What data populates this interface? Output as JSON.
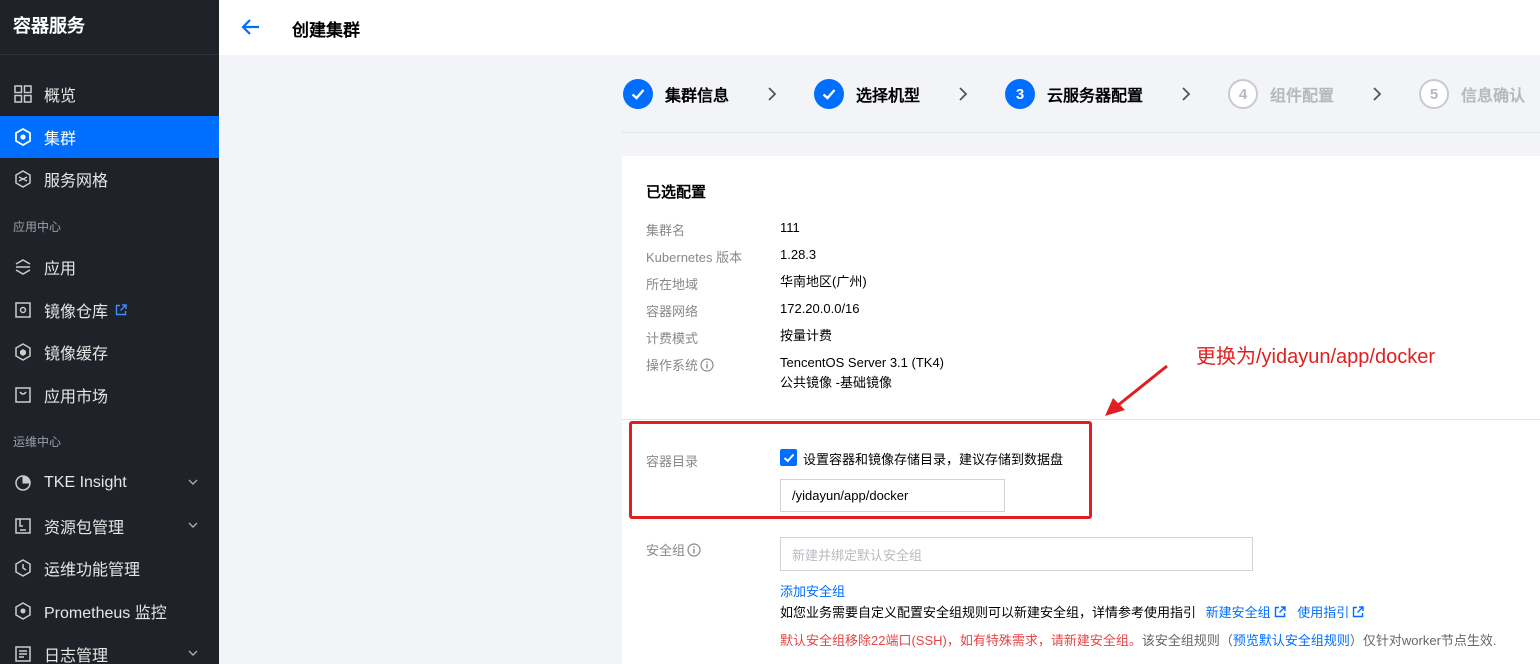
{
  "app": {
    "title": "容器服务"
  },
  "sidebar": {
    "items": [
      {
        "label": "概览"
      },
      {
        "label": "集群"
      },
      {
        "label": "服务网格"
      },
      {
        "label": "应用"
      },
      {
        "label": "镜像仓库"
      },
      {
        "label": "镜像缓存"
      },
      {
        "label": "应用市场"
      },
      {
        "label": "TKE Insight"
      },
      {
        "label": "资源包管理"
      },
      {
        "label": "运维功能管理"
      },
      {
        "label": "Prometheus 监控"
      },
      {
        "label": "日志管理"
      }
    ],
    "sections": [
      "应用中心",
      "运维中心"
    ]
  },
  "header": {
    "title": "创建集群"
  },
  "steps": [
    {
      "label": "集群信息",
      "state": "done"
    },
    {
      "label": "选择机型",
      "state": "done"
    },
    {
      "num": "3",
      "label": "云服务器配置",
      "state": "current"
    },
    {
      "num": "4",
      "label": "组件配置",
      "state": "todo"
    },
    {
      "num": "5",
      "label": "信息确认",
      "state": "todo"
    }
  ],
  "summary": {
    "title": "已选配置",
    "rows": [
      {
        "key": "集群名",
        "value": "111"
      },
      {
        "key": "Kubernetes 版本",
        "value": "1.28.3"
      },
      {
        "key": "所在地域",
        "value": "华南地区(广州)"
      },
      {
        "key": "容器网络",
        "value": "172.20.0.0/16"
      },
      {
        "key": "计费模式",
        "value": "按量计费"
      },
      {
        "key": "操作系统",
        "value": "TencentOS Server 3.1 (TK4)",
        "value2": "公共镜像 -基础镜像"
      }
    ]
  },
  "container_dir": {
    "label": "容器目录",
    "checkbox_label": "设置容器和镜像存储目录，建议存储到数据盘",
    "checked": true,
    "value": "/yidayun/app/docker"
  },
  "security_group": {
    "label": "安全组",
    "placeholder": "新建并绑定默认安全组",
    "add_link": "添加安全组",
    "hint": "如您业务需要自定义配置安全组规则可以新建安全组，详情参考使用指引",
    "new_link": "新建安全组",
    "guide_link": "使用指引",
    "warn_red": "默认安全组移除22端口(SSH)，如有特殊需求，请新建安全组。",
    "warn_gray": "该安全组规则（",
    "warn_link": "预览默认安全组规则",
    "warn_tail": "）仅针对worker节点生效."
  },
  "annotation": {
    "text": "更换为/yidayun/app/docker",
    "color": "#e02020"
  },
  "colors": {
    "accent": "#006eff",
    "sidebar_bg": "#1f2329",
    "warn": "#e54545"
  }
}
